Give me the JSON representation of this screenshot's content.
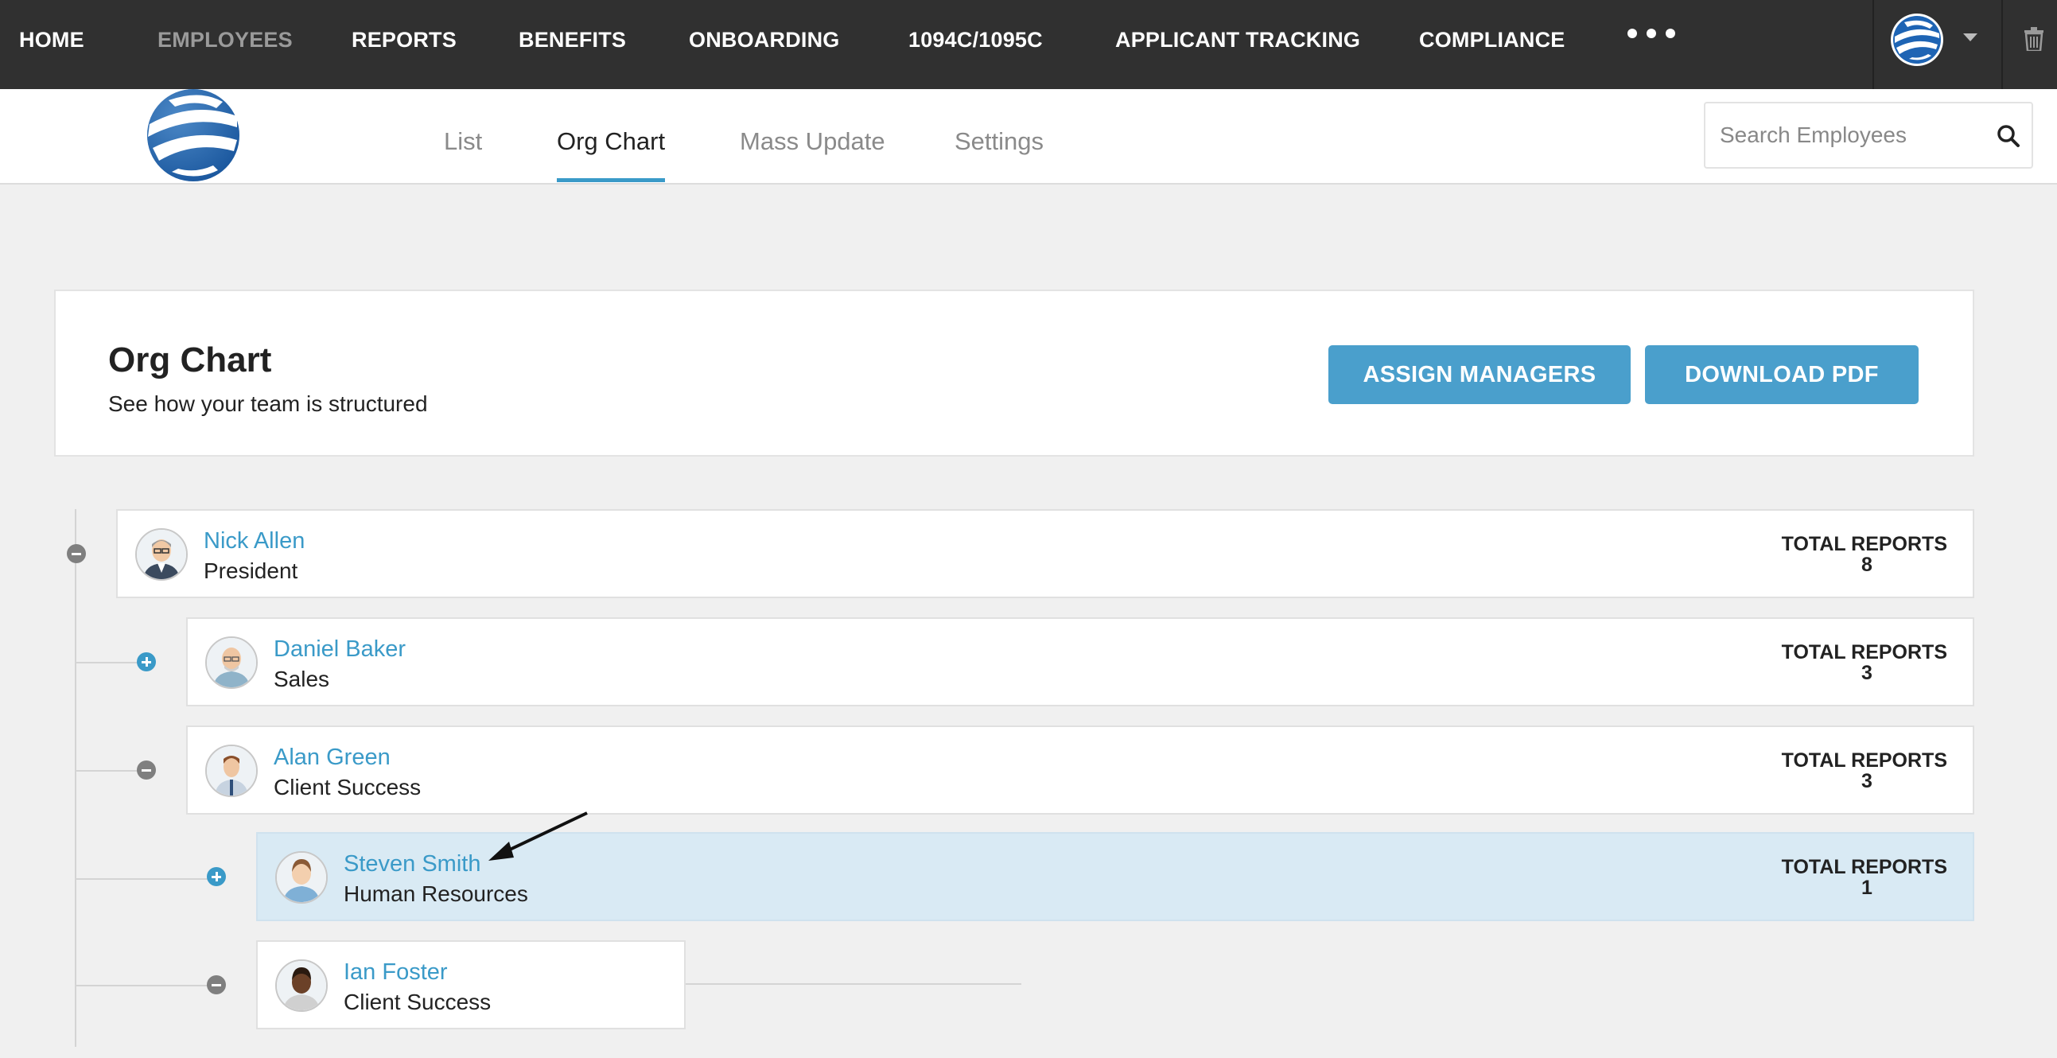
{
  "topnav": {
    "items": [
      {
        "label": "HOME",
        "active": false
      },
      {
        "label": "EMPLOYEES",
        "active": true
      },
      {
        "label": "REPORTS",
        "active": false
      },
      {
        "label": "BENEFITS",
        "active": false
      },
      {
        "label": "ONBOARDING",
        "active": false
      },
      {
        "label": "1094C/1095C",
        "active": false
      },
      {
        "label": "APPLICANT TRACKING",
        "active": false
      },
      {
        "label": "COMPLIANCE",
        "active": false
      }
    ],
    "more_icon": "ellipsis-icon",
    "user_menu_icon": "caret-down-icon",
    "trash_icon": "trash-icon"
  },
  "subnav": {
    "tabs": [
      {
        "label": "List",
        "active": false
      },
      {
        "label": "Org Chart",
        "active": true
      },
      {
        "label": "Mass Update",
        "active": false
      },
      {
        "label": "Settings",
        "active": false
      }
    ],
    "search": {
      "placeholder": "Search Employees",
      "value": ""
    }
  },
  "page": {
    "title": "Org Chart",
    "subtitle": "See how your team is structured",
    "buttons": {
      "assign_managers": "ASSIGN MANAGERS",
      "download_pdf": "DOWNLOAD PDF"
    }
  },
  "org": {
    "reports_label": "TOTAL REPORTS",
    "people": [
      {
        "name": "Nick Allen",
        "role": "President",
        "total_reports": "8",
        "expanded": true,
        "highlighted": false
      },
      {
        "name": "Daniel Baker",
        "role": "Sales",
        "total_reports": "3",
        "expanded": false,
        "highlighted": false
      },
      {
        "name": "Alan Green",
        "role": "Client Success",
        "total_reports": "3",
        "expanded": true,
        "highlighted": false
      },
      {
        "name": "Steven Smith",
        "role": "Human Resources",
        "total_reports": "1",
        "expanded": false,
        "highlighted": true
      },
      {
        "name": "Ian Foster",
        "role": "Client Success",
        "total_reports": "",
        "expanded": true,
        "highlighted": false
      }
    ]
  },
  "colors": {
    "accent": "#3a9ac8",
    "button": "#4a9fcc",
    "nav_bg": "#303030",
    "highlight_row": "#d9eaf4",
    "page_bg": "#f0f0f0"
  }
}
